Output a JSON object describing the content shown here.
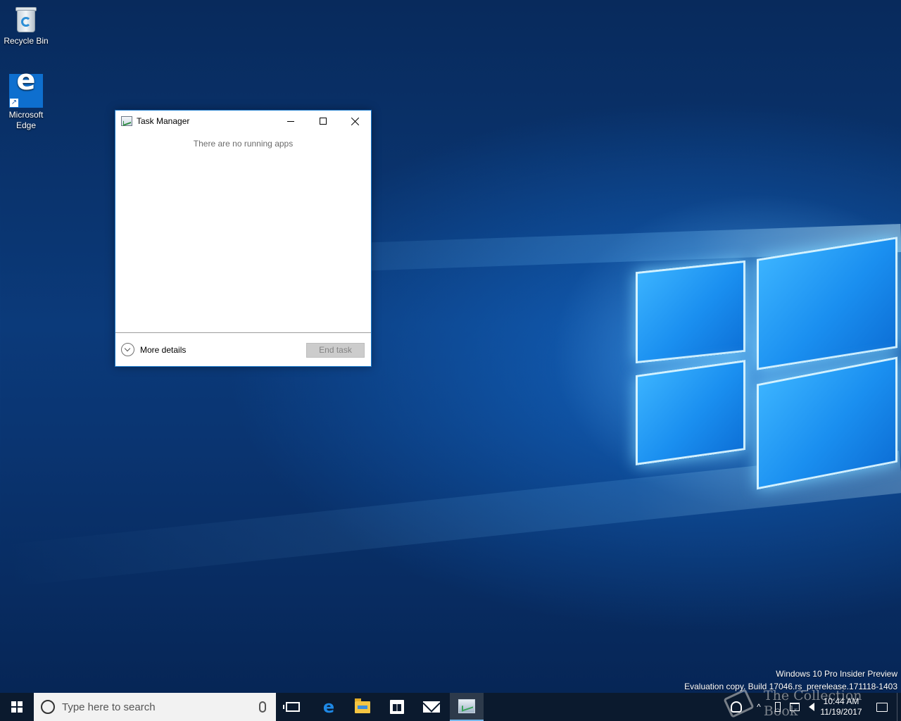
{
  "desktop": {
    "icons": [
      {
        "label": "Recycle Bin",
        "icon": "recycle-bin-icon"
      },
      {
        "label": "Microsoft\nEdge",
        "icon": "edge-icon"
      }
    ],
    "watermark": {
      "line1": "Windows 10 Pro Insider Preview",
      "line2": "Evaluation copy. Build 17046.rs_prerelease.171118-1403"
    },
    "overlay_stamp": "The Collection Book"
  },
  "task_manager": {
    "title": "Task Manager",
    "empty_message": "There are no running apps",
    "more_details_label": "More details",
    "end_task_label": "End task",
    "accent_color": "#1979ca"
  },
  "taskbar": {
    "search_placeholder": "Type here to search",
    "pinned": [
      {
        "name": "task-view",
        "icon": "task-view-icon"
      },
      {
        "name": "edge",
        "icon": "edge-icon"
      },
      {
        "name": "file-explorer",
        "icon": "folder-icon"
      },
      {
        "name": "store",
        "icon": "store-icon"
      },
      {
        "name": "mail",
        "icon": "mail-icon"
      },
      {
        "name": "task-manager",
        "icon": "task-manager-icon",
        "active": true
      }
    ],
    "clock": {
      "time": "10:44 AM",
      "date": "11/19/2017"
    },
    "tray_chevron": "^",
    "background_color": "#0b1a2e"
  }
}
